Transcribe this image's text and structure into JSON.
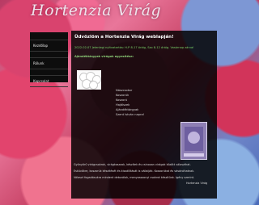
{
  "site": {
    "title": "Hortenzia Virág"
  },
  "nav": {
    "items": [
      "Kezdőlap",
      "Rólunk",
      "Kapcsolat"
    ]
  },
  "main": {
    "title": "Üdvözlöm a Hortenzia Virág weblapján!",
    "news": "2022.02.07 Jelenlegi nyitvatartás: H-P 8-17 óráig, Szo 8-12 óráig. Vasárnap zárva!",
    "section_label": "Ajándéktárgyak virágok egyesítése:",
    "list": [
      "Nászcsokor",
      "Koszorúk",
      "Koszorú",
      "Hajdíszek",
      "Ajándéktárgyak",
      "Szent István napra!"
    ],
    "body_lines": [
      "Gyönyörű virágcsokrok, virágkosarak, készítek és csinosan virágok között választhat.",
      "Esküvőkre, koszorúk készítését és kiszállítását is vállalják. Koszorúkat és vásárolhatnak.",
      "Választ fogadásukra mindent dekorálok, menyasszonyi csokrot készítünk. Igény szerint."
    ],
    "signature": "Hortenzia Virág"
  }
}
